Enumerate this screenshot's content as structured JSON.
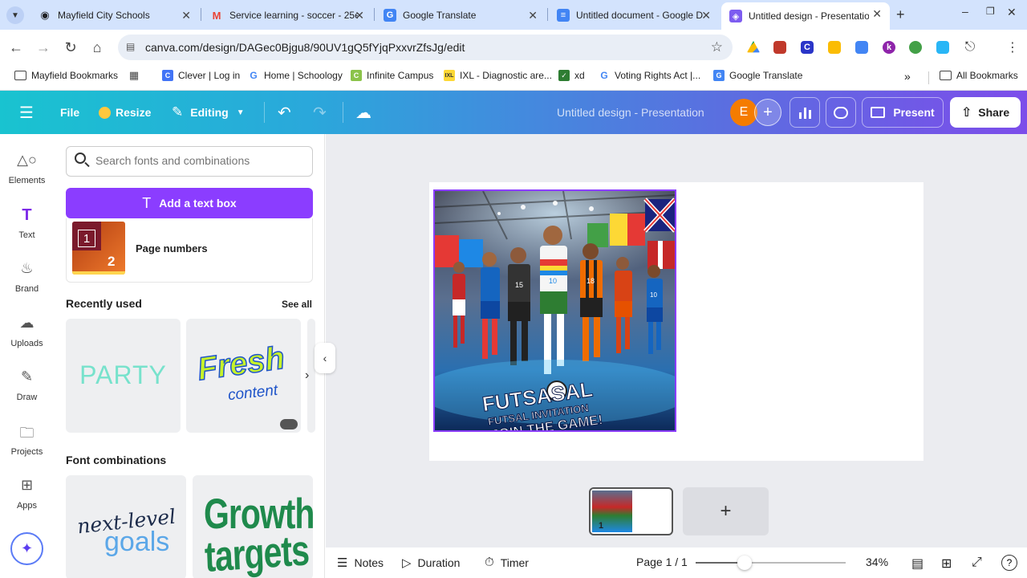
{
  "browser": {
    "tabs": [
      {
        "title": "Mayfield City Schools",
        "icon": "mayfield-icon",
        "color": "#202124"
      },
      {
        "title": "Service learning - soccer - 25e",
        "icon": "gmail-icon",
        "color": "#ea4335"
      },
      {
        "title": "Google Translate",
        "icon": "translate-icon",
        "color": "#4285f4"
      },
      {
        "title": "Untitled document - Google D",
        "icon": "docs-icon",
        "color": "#4285f4"
      },
      {
        "title": "Untitled design - Presentation",
        "icon": "canva-icon",
        "color": "#00c4cc",
        "active": true
      }
    ],
    "url": "canva.com/design/DAGec0Bjgu8/90UV1gQ5fYjqPxxvrZfsJg/edit",
    "bookmarks": [
      {
        "label": "Mayfield Bookmarks",
        "icon": "folder-icon"
      },
      {
        "label": "",
        "icon": "apps-grid-icon"
      },
      {
        "label": "Clever | Log in",
        "icon": "clever-icon"
      },
      {
        "label": "Home | Schoology",
        "icon": "google-icon"
      },
      {
        "label": "Infinite Campus",
        "icon": "campus-icon"
      },
      {
        "label": "IXL - Diagnostic are...",
        "icon": "ixl-icon"
      },
      {
        "label": "xd",
        "icon": "xd-icon"
      },
      {
        "label": "Voting Rights Act |...",
        "icon": "google-icon"
      },
      {
        "label": "Google Translate",
        "icon": "translate-icon"
      }
    ],
    "all_bookmarks": "All Bookmarks"
  },
  "header": {
    "file": "File",
    "resize": "Resize",
    "editing": "Editing",
    "title": "Untitled design - Presentation",
    "avatar": "E",
    "present": "Present",
    "share": "Share"
  },
  "rail": [
    {
      "label": "Elements",
      "icon": "shapes-icon"
    },
    {
      "label": "Text",
      "icon": "text-icon"
    },
    {
      "label": "Brand",
      "icon": "brand-icon"
    },
    {
      "label": "Uploads",
      "icon": "cloud-upload-icon"
    },
    {
      "label": "Draw",
      "icon": "pen-icon"
    },
    {
      "label": "Projects",
      "icon": "folder-icon"
    },
    {
      "label": "Apps",
      "icon": "apps-icon"
    }
  ],
  "panel": {
    "search_placeholder": "Search fonts and combinations",
    "add_text": "Add a text box",
    "page_numbers": "Page numbers",
    "page_numbers_digits": [
      "1",
      "2"
    ],
    "recently_used": "Recently used",
    "see_all": "See all",
    "recent": [
      {
        "text": "PARTY"
      },
      {
        "text": "Fresh",
        "subtext": "content"
      }
    ],
    "font_combinations": "Font combinations",
    "combos": [
      {
        "line1": "next-level",
        "line2": "goals"
      },
      {
        "line1": "Growth",
        "line2": "targets"
      }
    ]
  },
  "canvas": {
    "poster_text": [
      "FUTSASAL",
      "FUTSAL INVITATION",
      "JOIN THE GAME!"
    ],
    "jersey_numbers": [
      "15",
      "10",
      "18",
      "10"
    ],
    "thumb_page": "1"
  },
  "footer": {
    "notes": "Notes",
    "duration": "Duration",
    "timer": "Timer",
    "page": "Page 1 / 1",
    "zoom": "34%",
    "zoom_level_percent": 34
  }
}
